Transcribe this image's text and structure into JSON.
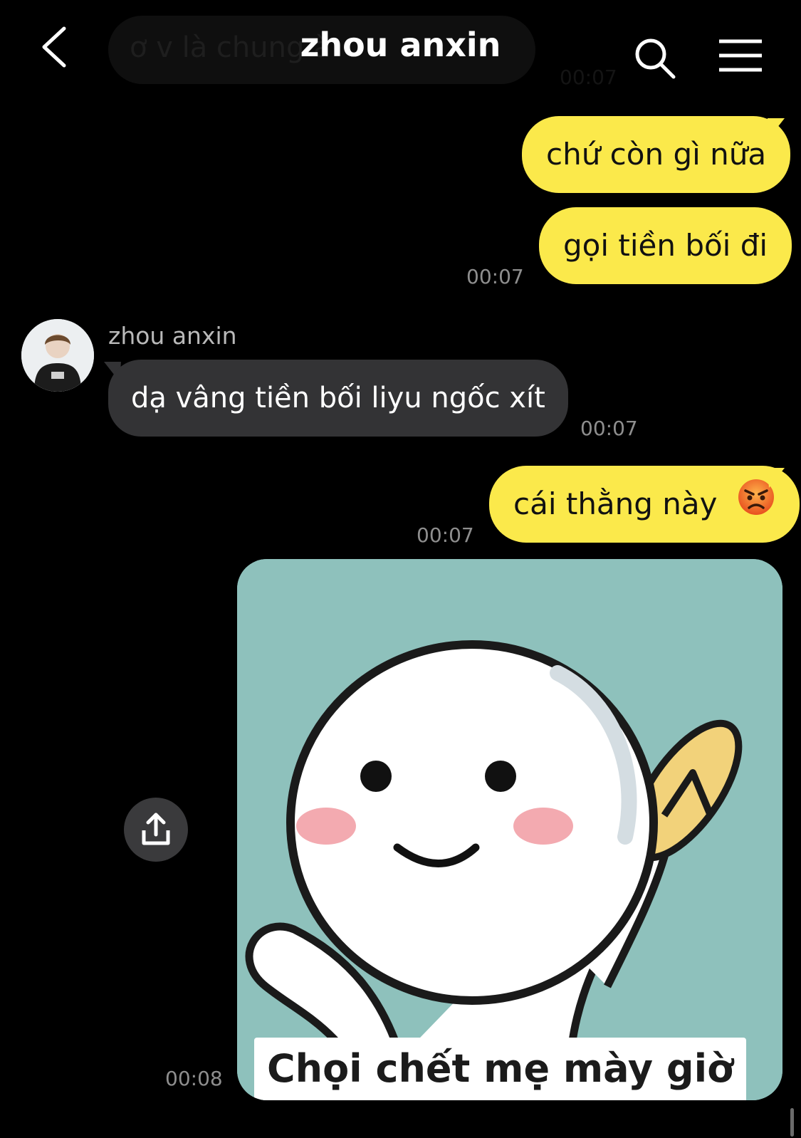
{
  "header": {
    "title": "zhou anxin",
    "ghost_message": "ơ v là chung à",
    "ghost_time": "00:07"
  },
  "messages": [
    {
      "text": "chứ còn gì nữa"
    },
    {
      "text": "gọi tiền bối đi",
      "time": "00:07"
    },
    {
      "sender": "zhou anxin",
      "text": "dạ vâng tiền bối liyu ngốc xít",
      "time": "00:07"
    },
    {
      "text": "cái thằng này",
      "emoji": "😡",
      "time": "00:07"
    },
    {
      "sticker_caption": "Chọi chết mẹ mày giờ",
      "time": "00:08"
    }
  ],
  "colors": {
    "background": "#000000",
    "outgoing_bubble": "#fbe94b",
    "incoming_bubble": "#333335",
    "sticker_bg": "#8ec1bc"
  },
  "icons": [
    "back-arrow-icon",
    "search-icon",
    "menu-icon",
    "share-icon",
    "angry-face-icon"
  ]
}
